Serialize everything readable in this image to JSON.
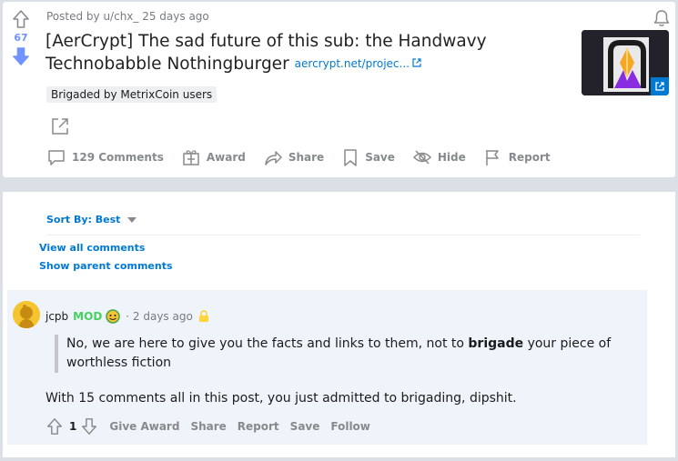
{
  "post": {
    "meta": "Posted by u/chx_  25 days ago",
    "vote_count": "67",
    "title": "[AerCrypt] The sad future of this sub: the Handwavy Technobabble Nothingburger",
    "link_text": "aercrypt.net/projec...",
    "flair": "Brigaded by MetrixCoin users",
    "actions": {
      "comments": "129 Comments",
      "award": "Award",
      "share": "Share",
      "save": "Save",
      "hide": "Hide",
      "report": "Report"
    }
  },
  "comments_section": {
    "sort_label": "Sort By: Best",
    "view_all": "View all comments",
    "show_parent": "Show parent comments"
  },
  "comment": {
    "author": "jcpb",
    "mod_badge": "MOD",
    "time": "· 2 days ago",
    "quote_before": "No, we are here to give you the facts and links to them, not to ",
    "quote_bold": "brigade",
    "quote_after": " your piece of worthless fiction",
    "body": "With 15 comments all in this post, you just admitted to brigading, dipshit.",
    "score": "1",
    "actions": {
      "give_award": "Give Award",
      "share": "Share",
      "report": "Report",
      "save": "Save",
      "follow": "Follow"
    }
  },
  "colors": {
    "link_blue": "#0079d3",
    "mod_green": "#46d160",
    "vote_blue": "#7193ff",
    "comment_bg": "#eef4fa"
  }
}
